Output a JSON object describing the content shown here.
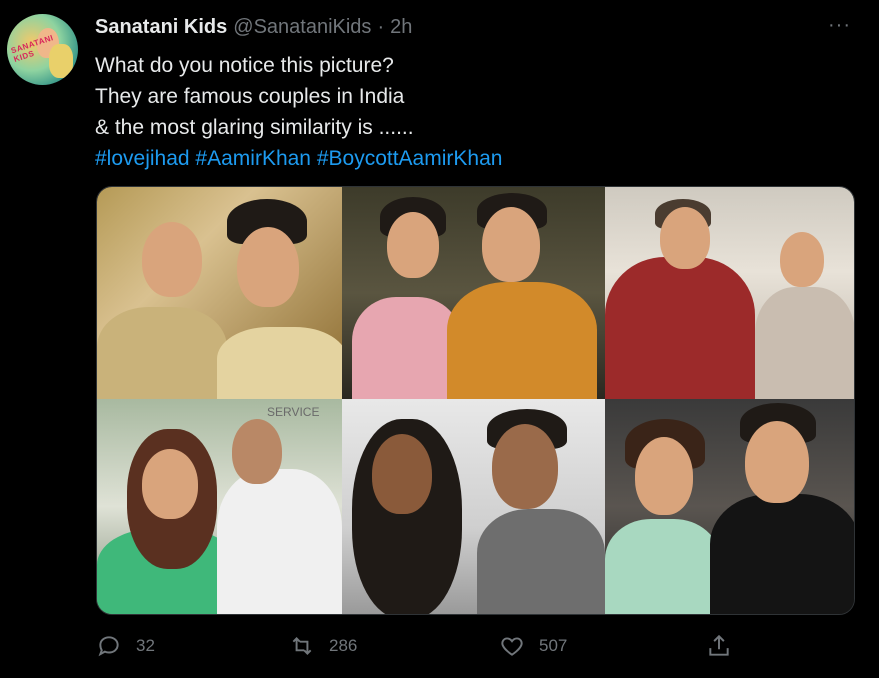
{
  "tweet": {
    "display_name": "Sanatani Kids",
    "handle": "@SanataniKids",
    "separator": "·",
    "time": "2h",
    "more": "···",
    "avatar_text": "SANATANI KIDS",
    "lines": [
      "What do you notice this picture?",
      "They are famous couples in India",
      "& the most glaring similarity is ......"
    ],
    "hashtags": [
      "#lovejihad",
      "#AamirKhan",
      "#BoycottAamirKhan"
    ],
    "media_sign_text": "SERVICE"
  },
  "actions": {
    "reply_count": "32",
    "retweet_count": "286",
    "like_count": "507"
  },
  "colors": {
    "background": "#000000",
    "text": "#e7e9ea",
    "muted": "#71767b",
    "link": "#1d9bf0"
  }
}
